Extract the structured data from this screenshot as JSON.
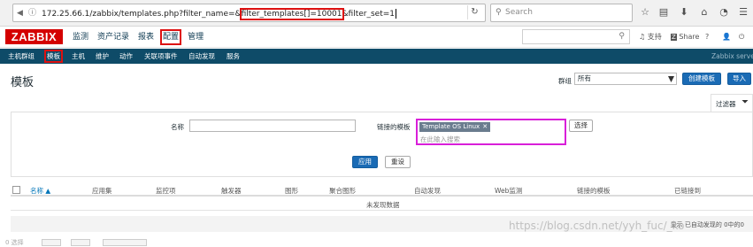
{
  "browser": {
    "url_prefix": "172.25.66.1/zabbix/templates.php?filter_name=&",
    "url_highlight": "filter_templates[]=10001",
    "url_suffix": "&filter_set=1",
    "search_placeholder": "Search",
    "icons": [
      "info-icon",
      "back-icon",
      "reload-icon",
      "star-icon",
      "reader-icon",
      "download-icon",
      "home-icon",
      "pocket-icon",
      "menu-icon"
    ]
  },
  "header": {
    "logo": "ZABBIX",
    "menu": [
      "监测",
      "资产记录",
      "报表",
      "配置",
      "管理"
    ],
    "active_menu": "配置",
    "support": "支持",
    "share": "Share",
    "help": "?",
    "user": "",
    "logout": ""
  },
  "submenu": {
    "items": [
      "主机群组",
      "模板",
      "主机",
      "维护",
      "动作",
      "关联项事件",
      "自动发现",
      "服务"
    ],
    "selected": "模板",
    "right_text": "Zabbix serve"
  },
  "page": {
    "title": "模板",
    "group_label": "群组",
    "group_value": "所有",
    "create_button": "创建模板",
    "import_button": "导入"
  },
  "filter": {
    "tab_label": "过滤器",
    "name_label": "名称",
    "name_value": "",
    "linked_label": "链接的模板",
    "linked_tag": "Template OS Linux",
    "linked_placeholder": "在此输入搜索",
    "select_button": "选择",
    "apply_button": "应用",
    "reset_button": "重设"
  },
  "table": {
    "columns": [
      "名称 ▲",
      "应用集",
      "监控项",
      "触发器",
      "图形",
      "聚合图形",
      "自动发现",
      "Web监测",
      "链接的模板",
      "已链接到"
    ],
    "empty_text": "未发现数据",
    "footer_text": "显示 已自动发现的 0中的0",
    "bottom_text": "0 选择"
  },
  "watermark": "https://blog.csdn.net/yyh_fuc/_ko"
}
